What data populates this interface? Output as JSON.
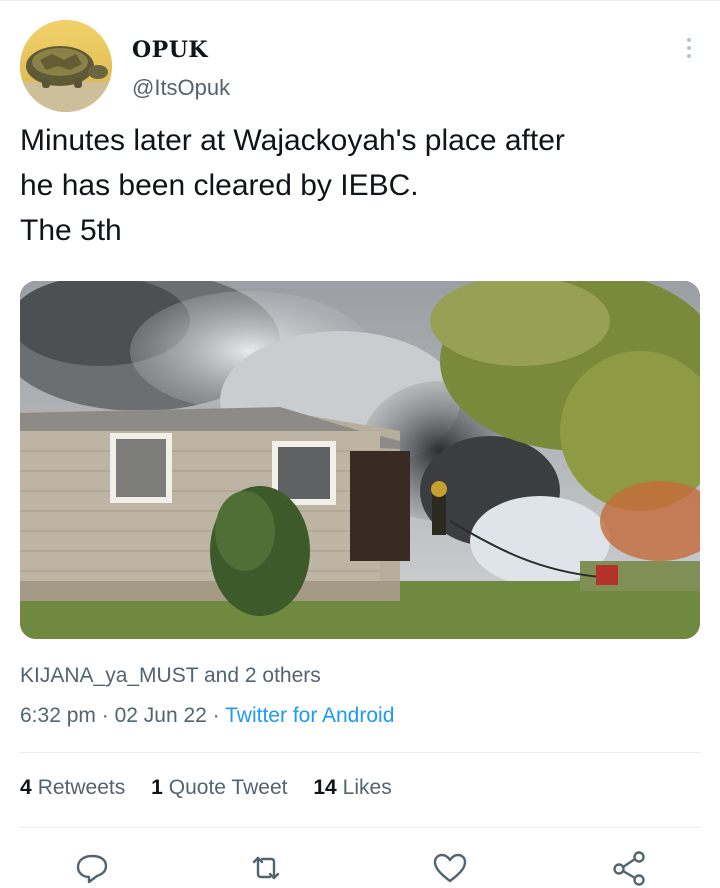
{
  "tweet": {
    "author_name": "OPUK",
    "author_handle": "@ItsOpuk",
    "text": "Minutes later at Wajackoyah's place after\nhe has been cleared by IEBC.\nThe 5th",
    "likers": "KIJANA_ya_MUST and 2 others",
    "time": "6:32 pm",
    "date": "02 Jun 22",
    "separator": "·",
    "source": "Twitter for Android"
  },
  "stats": {
    "retweets_count": "4",
    "retweets_label": "Retweets",
    "quotes_count": "1",
    "quotes_label": "Quote Tweet",
    "likes_count": "14",
    "likes_label": "Likes"
  },
  "icons": {
    "avatar": "tortoise-avatar",
    "more": "more-vertical-icon",
    "reply": "reply-icon",
    "retweet": "retweet-icon",
    "like": "heart-icon",
    "share": "share-icon"
  },
  "colors": {
    "link": "#1d9bf0",
    "secondary_text": "#536471",
    "icon": "#536471"
  }
}
